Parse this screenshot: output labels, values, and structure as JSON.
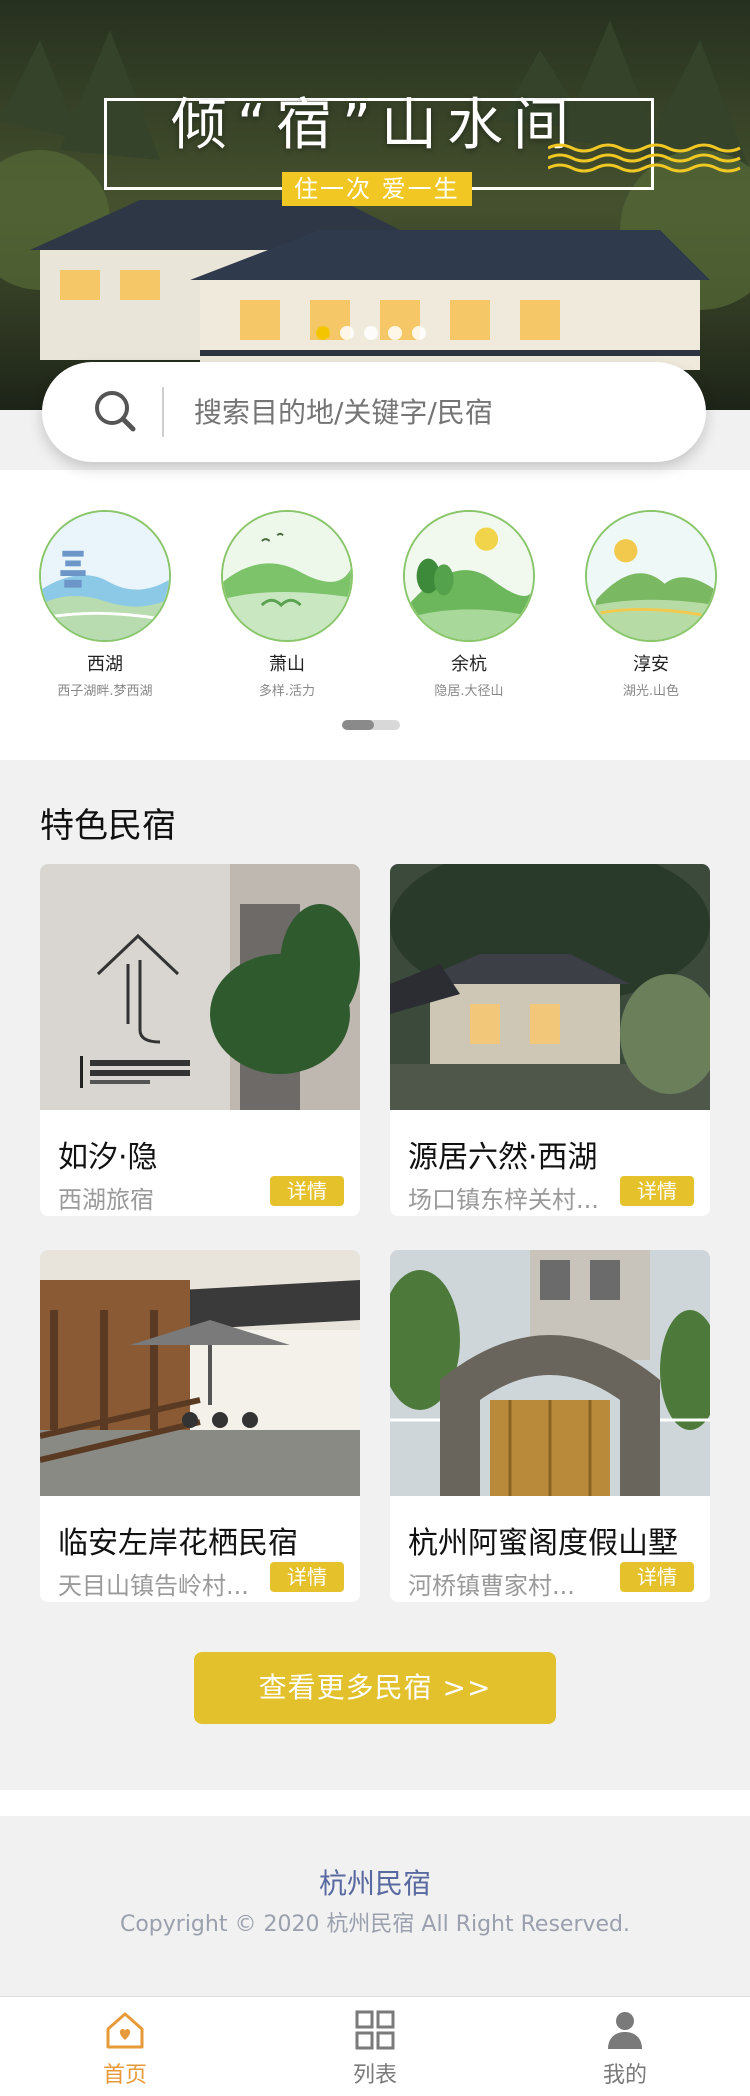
{
  "hero": {
    "title": "倾“宿”山水间",
    "tagline": "住一次 爱一生",
    "carousel_count": 5,
    "active_index": 0
  },
  "search": {
    "placeholder": "搜索目的地/关键字/民宿"
  },
  "destinations": [
    {
      "name": "西湖",
      "sub": "西子湖畔.梦西湖",
      "icon": "pagoda-lake-icon"
    },
    {
      "name": "萧山",
      "sub": "多样.活力",
      "icon": "bridge-hills-icon"
    },
    {
      "name": "余杭",
      "sub": "隐居.大径山",
      "icon": "trees-mountain-icon"
    },
    {
      "name": "淳安",
      "sub": "湖光.山色",
      "icon": "sun-hills-icon"
    }
  ],
  "featured": {
    "section_title": "特色民宿",
    "detail_label": "详情",
    "cards": [
      {
        "title": "如汐·隐",
        "location": "西湖旅宿"
      },
      {
        "title": "源居六然·西湖",
        "location": "场口镇东梓关村..."
      },
      {
        "title": "临安左岸花栖民宿",
        "location": "天目山镇告岭村..."
      },
      {
        "title": "杭州阿蜜阁度假山墅",
        "location": "河桥镇曹家村..."
      }
    ],
    "more_button": "查看更多民宿 >>"
  },
  "footer": {
    "brand": "杭州民宿",
    "copyright": "Copyright © 2020 杭州民宿 All Right Reserved."
  },
  "tabbar": {
    "items": [
      {
        "label": "首页",
        "icon": "home-icon",
        "active": true
      },
      {
        "label": "列表",
        "icon": "grid-icon",
        "active": false
      },
      {
        "label": "我的",
        "icon": "user-icon",
        "active": false
      }
    ]
  },
  "colors": {
    "accent": "#e2c12d",
    "active_tab": "#e79a3a",
    "brand_text": "#596aa0"
  }
}
